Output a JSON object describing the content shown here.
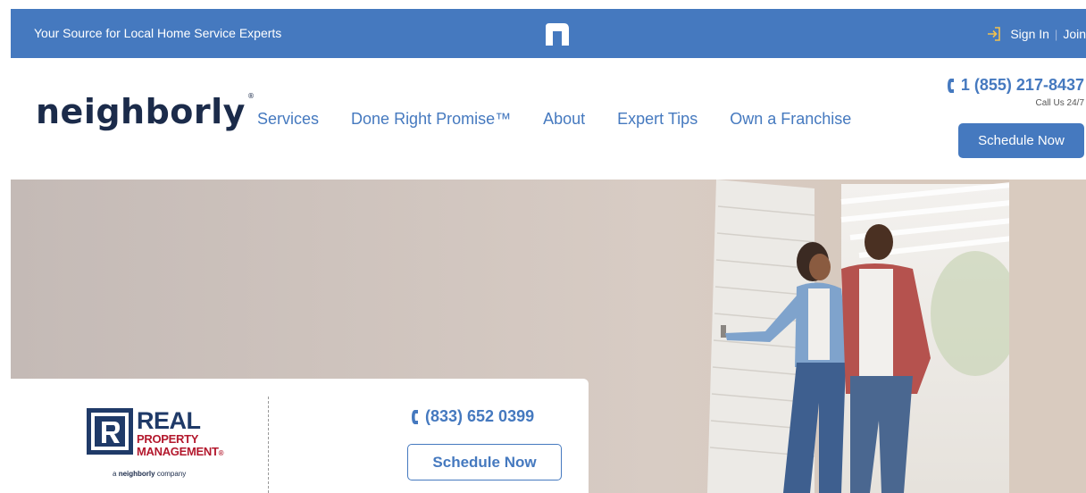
{
  "topbar": {
    "tagline": "Your Source for Local Home Service Experts",
    "signin_label": "Sign In",
    "separator": "|",
    "join_label": "Join",
    "bg_color": "#4579bf"
  },
  "header": {
    "logo_text": "neighborly",
    "nav": [
      {
        "label": "Services"
      },
      {
        "label": "Done Right Promise™"
      },
      {
        "label": "About"
      },
      {
        "label": "Expert Tips"
      },
      {
        "label": "Own a Franchise"
      }
    ],
    "phone": "1 (855) 217-8437",
    "phone_note": "Call Us 24/7",
    "schedule_label": "Schedule Now",
    "accent_color": "#4579bf"
  },
  "franchise_card": {
    "brand_line1": "REAL",
    "brand_line2": "PROPERTY",
    "brand_line3": "MANAGEMENT",
    "brand_tagline_prefix": "a",
    "brand_tagline_brand": "neighborly",
    "brand_tagline_suffix": "company",
    "phone": "(833) 652 0399",
    "schedule_label": "Schedule Now",
    "brand_navy": "#1f3a68",
    "brand_red": "#b3182d"
  },
  "icons": {
    "topbar_mark": "neighborly-n-icon",
    "signin": "sign-in-arrow-icon",
    "phone": "phone-icon"
  }
}
